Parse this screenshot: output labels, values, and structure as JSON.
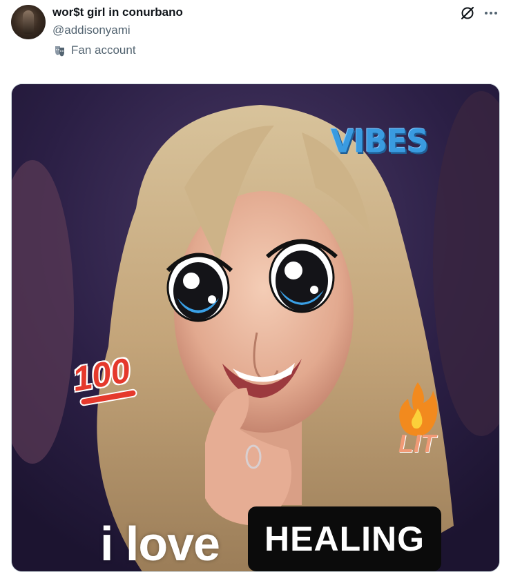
{
  "author": {
    "display_name": "wor$t girl in conurbano",
    "handle": "@addisonyami",
    "badge_label": "Fan account",
    "badge_icon": "theater-masks-icon"
  },
  "actions": {
    "grok_icon": "grok-icon",
    "more_icon": "more-dots-icon"
  },
  "media": {
    "caption_left": "i love",
    "caption_box": "HEALING",
    "sticker_vibes": "VIBES",
    "sticker_100": "100",
    "sticker_lit": "LIT",
    "colors": {
      "vibes": "#3a9be0",
      "hundred": "#e5392c",
      "caption_box_bg": "#0b0b0b"
    }
  }
}
